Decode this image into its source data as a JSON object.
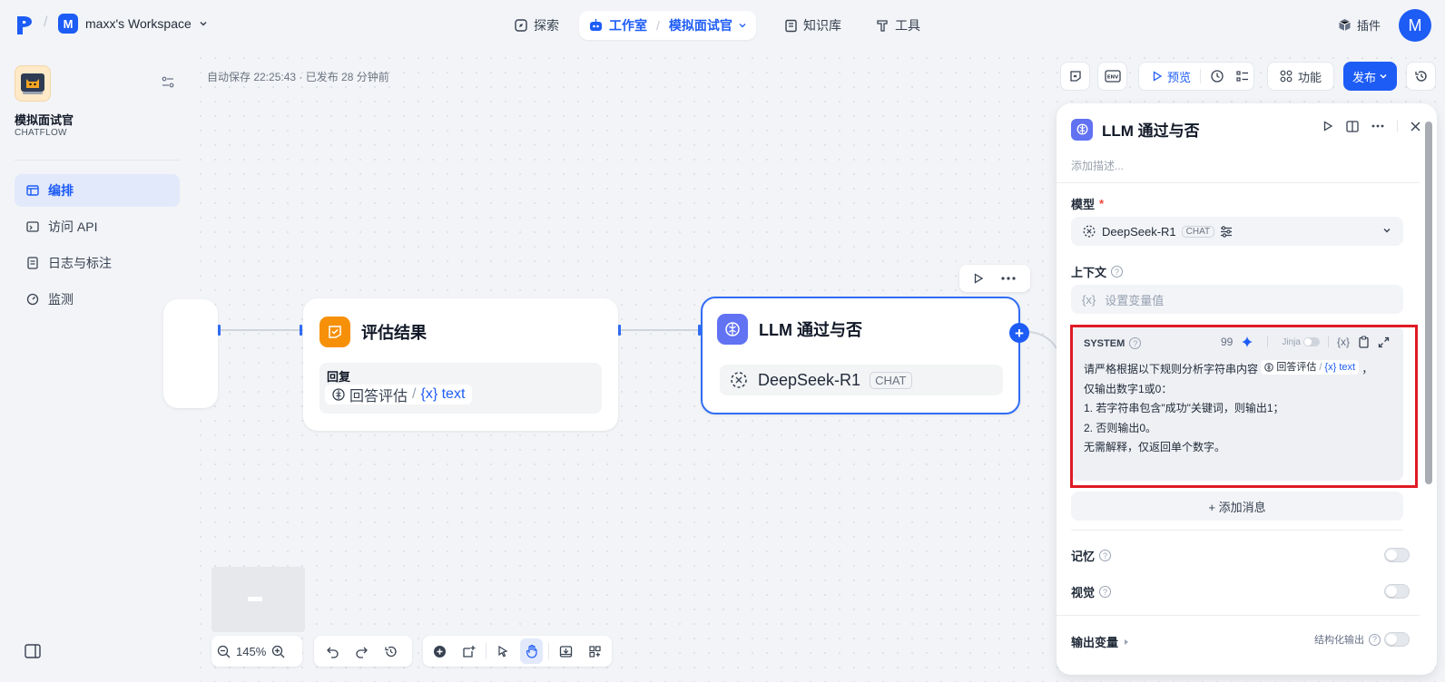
{
  "topbar": {
    "workspace_initial": "M",
    "workspace_name": "maxx's Workspace",
    "nav_explore": "探索",
    "nav_studio": "工作室",
    "nav_current_app": "模拟面试官",
    "nav_knowledge": "知识库",
    "nav_tools": "工具",
    "plugins": "插件",
    "avatar_initial": "M"
  },
  "sidebar": {
    "app_name": "模拟面试官",
    "app_type": "CHATFLOW",
    "items": [
      {
        "label": "编排",
        "icon": "layout-icon",
        "active": true
      },
      {
        "label": "访问 API",
        "icon": "terminal-icon",
        "active": false
      },
      {
        "label": "日志与标注",
        "icon": "document-icon",
        "active": false
      },
      {
        "label": "监测",
        "icon": "gauge-icon",
        "active": false
      }
    ]
  },
  "canvas": {
    "autosave": "自动保存 22:25:43 · 已发布 28 分钟前",
    "toolbar": {
      "preview": "预览",
      "features": "功能",
      "publish": "发布"
    },
    "zoom": "145%",
    "nodes": {
      "eval": {
        "title": "评估结果",
        "field_label": "回复",
        "ref_node": "回答评估",
        "ref_sep": "/",
        "ref_var": "{x} text"
      },
      "llm": {
        "title": "LLM 通过与否",
        "model": "DeepSeek-R1",
        "model_tag": "CHAT"
      }
    }
  },
  "panel": {
    "title": "LLM 通过与否",
    "description_placeholder": "添加描述...",
    "model_label": "模型",
    "required_mark": "*",
    "model_name": "DeepSeek-R1",
    "model_tag": "CHAT",
    "context_label": "上下文",
    "context_var_icon": "{x}",
    "context_placeholder": "设置变量值",
    "system": {
      "label": "SYSTEM",
      "token_count": "99",
      "jinja": "Jinja",
      "var_btn": "{x}",
      "line1_prefix": "请严格根据以下规则分析字符串内容",
      "ref_node": "回答评估",
      "ref_sep": "/",
      "ref_var": "{x} text",
      "line1_suffix": "，",
      "line2": "仅输出数字1或0：",
      "line3": "1. 若字符串包含\"成功\"关键词，则输出1；",
      "line4": "2. 否则输出0。",
      "line5": "无需解释，仅返回单个数字。"
    },
    "add_message": "+ 添加消息",
    "memory_label": "记忆",
    "vision_label": "视觉",
    "output_vars_label": "输出变量",
    "structured_output_label": "结构化输出",
    "help_glyph": "?"
  },
  "colors": {
    "primary": "#1d5cf5",
    "llm_icon": "#6172f3",
    "eval_icon": "#f79009",
    "highlight_outline": "#e01b24"
  }
}
